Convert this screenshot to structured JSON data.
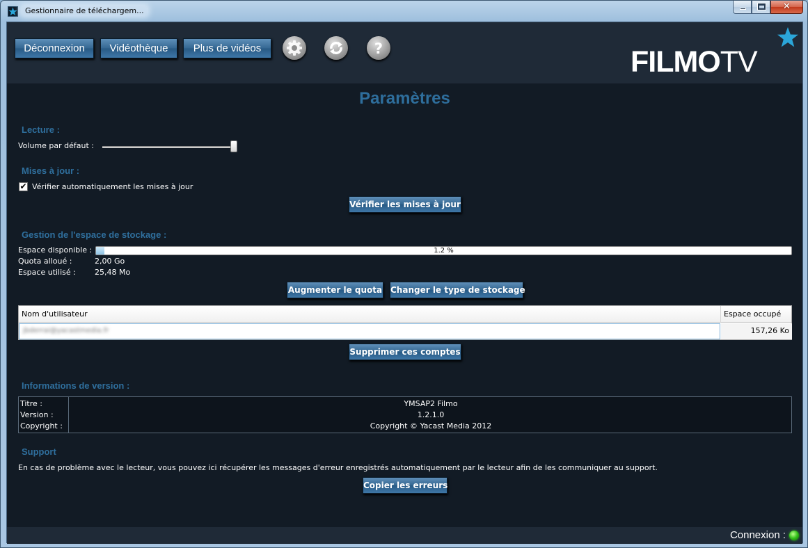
{
  "window": {
    "title": "Gestionnaire de téléchargem...",
    "controls": {
      "minimize": "minimize",
      "maximize": "maximize",
      "close": "✕"
    }
  },
  "header": {
    "nav": [
      {
        "label": "Déconnexion"
      },
      {
        "label": "Vidéothèque"
      },
      {
        "label": "Plus de vidéos"
      }
    ],
    "icons": [
      "gear-icon",
      "refresh-icon",
      "help-icon"
    ],
    "logo": {
      "bold": "FILMO",
      "light": "TV"
    }
  },
  "page": {
    "title": "Paramètres"
  },
  "lecture": {
    "title": "Lecture :",
    "volume_label": "Volume par défaut :",
    "volume_level": 1.0
  },
  "updates": {
    "title": "Mises à jour :",
    "auto_check_label": "Vérifier automatiquement les mises à jour",
    "auto_check": true,
    "check_button": "Vérifier les mises à jour"
  },
  "storage": {
    "title": "Gestion de l'espace de stockage :",
    "available_label": "Espace disponible :",
    "progress_text": "1.2 %",
    "progress_fraction": 0.012,
    "quota_label": "Quota alloué :",
    "quota_value": "2,00 Go",
    "used_label": "Espace utilisé :",
    "used_value": "25,48 Mo",
    "increase_button": "Augmenter le quota",
    "change_type_button": "Changer le type de stockage",
    "table": {
      "columns": [
        "Nom d'utilisateur",
        "Espace occupé"
      ],
      "rows": [
        {
          "user": "jbderrai@yacastmedia.fr",
          "space": "157,26 Ko"
        }
      ]
    },
    "delete_button": "Supprimer ces comptes"
  },
  "version": {
    "title": "Informations de version :",
    "rows": [
      {
        "label": "Titre :",
        "value": "YMSAP2 Filmo"
      },
      {
        "label": "Version :",
        "value": "1.2.1.0"
      },
      {
        "label": "Copyright :",
        "value": "Copyright © Yacast Media 2012"
      }
    ]
  },
  "support": {
    "title": "Support",
    "description": "En cas de problème avec le lecteur, vous pouvez ici récupérer les messages d'erreur enregistrés automatiquement par le lecteur afin de les communiquer au support.",
    "copy_button": "Copier les erreurs"
  },
  "status": {
    "label": "Connexion :",
    "state_color": "#34c01a"
  },
  "colors": {
    "accent": "#2f6f9d",
    "background": "#121b25",
    "button": "#336690"
  }
}
